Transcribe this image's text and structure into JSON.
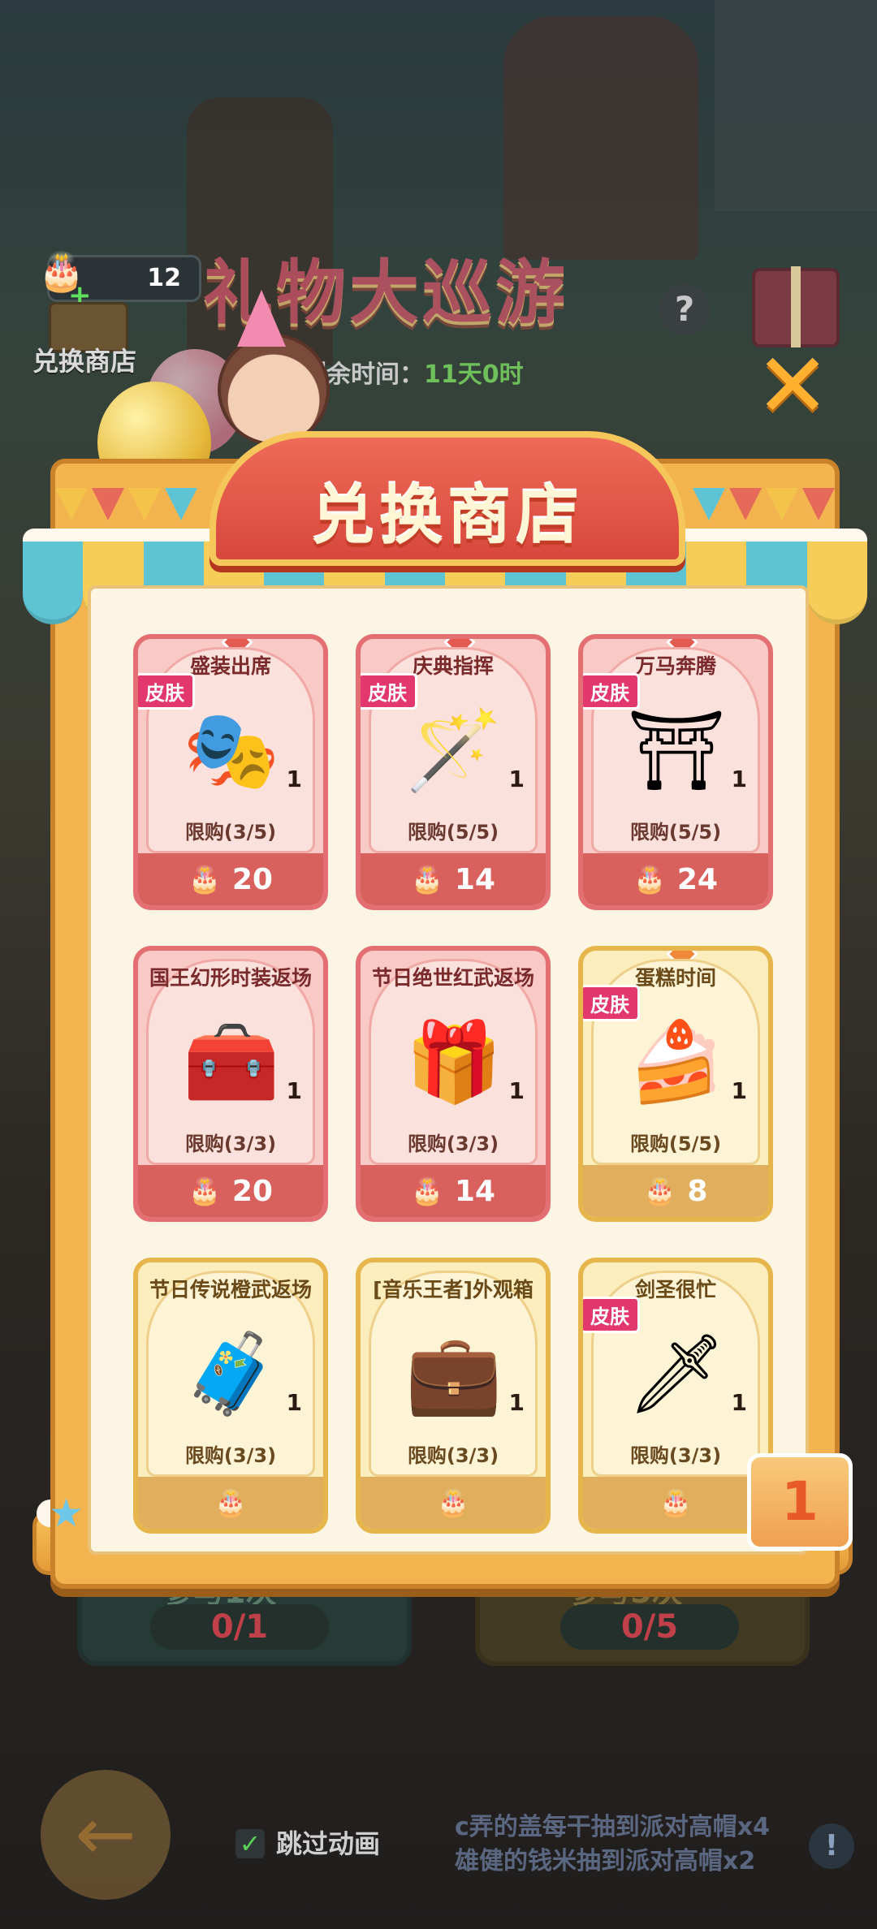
{
  "hud": {
    "currency_count": "12",
    "shop_label": "兑换商店",
    "event_title": "礼物大巡游",
    "help": "?",
    "timer_label": "剩余时间：",
    "timer_value": "11天0时"
  },
  "modal": {
    "title": "兑换商店",
    "close": "✕",
    "skin_tag": "皮肤",
    "items": [
      {
        "name": "盛装出席",
        "skin": true,
        "qty": "1",
        "limit": "限购(3/5)",
        "price": "20",
        "icon": "masked-hero-icon",
        "style": "red"
      },
      {
        "name": "庆典指挥",
        "skin": true,
        "qty": "1",
        "limit": "限购(5/5)",
        "price": "14",
        "icon": "baton-icon",
        "style": "red"
      },
      {
        "name": "万马奔腾",
        "skin": true,
        "qty": "1",
        "limit": "限购(5/5)",
        "price": "24",
        "icon": "ornate-gate-icon",
        "style": "red"
      },
      {
        "name": "国王幻形时装返场",
        "skin": false,
        "qty": "1",
        "limit": "限购(3/3)",
        "price": "20",
        "icon": "pink-chest-icon",
        "style": "red"
      },
      {
        "name": "节日绝世红武返场",
        "skin": false,
        "qty": "1",
        "limit": "限购(3/3)",
        "price": "14",
        "icon": "gift-box-icon",
        "style": "red"
      },
      {
        "name": "蛋糕时间",
        "skin": true,
        "qty": "1",
        "limit": "限购(5/5)",
        "price": "8",
        "icon": "cake-staff-icon",
        "style": "gold"
      },
      {
        "name": "节日传说橙武返场",
        "skin": false,
        "qty": "1",
        "limit": "限购(3/3)",
        "price": "",
        "icon": "gold-chest-icon",
        "style": "gold"
      },
      {
        "name": "[音乐王者]外观箱",
        "skin": false,
        "qty": "1",
        "limit": "限购(3/3)",
        "price": "",
        "icon": "teal-chest-icon",
        "style": "gold"
      },
      {
        "name": "剑圣很忙",
        "skin": true,
        "qty": "1",
        "limit": "限购(3/3)",
        "price": "",
        "icon": "swordsman-icon",
        "style": "gold"
      }
    ]
  },
  "bottom": {
    "tier_badge": "1",
    "left_progress": "0/1",
    "right_progress": "0/5",
    "skip_label": "跳过动画",
    "ticker_lines": [
      "c弄的盖每干抽到派对高帽x4",
      "雄健的钱米抽到派对高帽x2"
    ],
    "info": "!"
  },
  "colors": {
    "accent": "#d9615d",
    "gold": "#e0ae5c",
    "awning_teal": "#5ec3d2",
    "awning_yellow": "#f6cd58"
  }
}
